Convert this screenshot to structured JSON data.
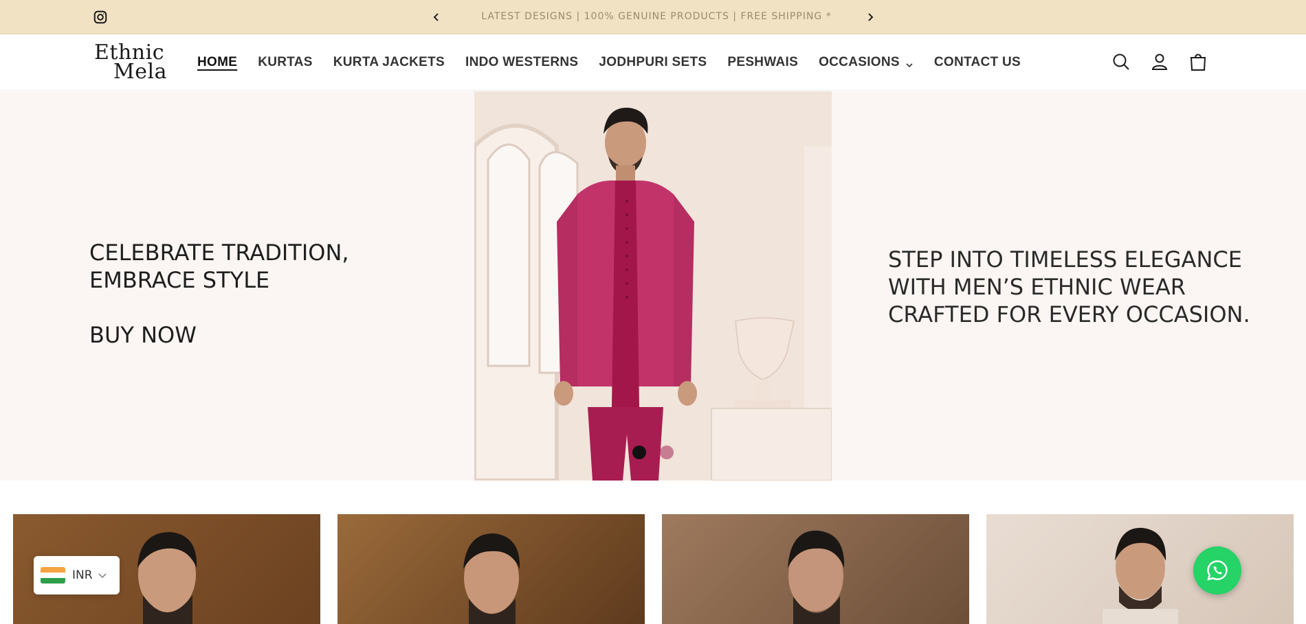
{
  "announcement": {
    "message": "LATEST DESIGNS | 100% GENUINE PRODUCTS | FREE SHIPPING *",
    "instagram_icon": "instagram-icon",
    "prev_icon": "chevron-left-icon",
    "next_icon": "chevron-right-icon"
  },
  "header": {
    "logo_line1": "Ethnic",
    "logo_line2": "Mela",
    "nav": [
      {
        "label": "HOME",
        "active": true
      },
      {
        "label": "KURTAS"
      },
      {
        "label": "KURTA JACKETS"
      },
      {
        "label": "INDO WESTERNS"
      },
      {
        "label": "JODHPURI SETS"
      },
      {
        "label": "PESHWAIS"
      },
      {
        "label": "OCCASIONS",
        "dropdown": true
      },
      {
        "label": "CONTACT US"
      }
    ],
    "icons": [
      "search-icon",
      "account-icon",
      "cart-icon"
    ]
  },
  "hero": {
    "left_line1": "CELEBRATE TRADITION,",
    "left_line2": "EMBRACE STYLE",
    "cta": "BUY NOW",
    "right_line1": "STEP INTO TIMELESS ELEGANCE",
    "right_line2": "WITH MEN’S ETHNIC WEAR",
    "right_line3": "CRAFTED FOR EVERY OCCASION.",
    "slides_total": 2,
    "active_slide": 1
  },
  "currency": {
    "code": "INR"
  },
  "colors": {
    "announcement_bg": "#f2e2c4",
    "hero_bg": "#fbf6f3",
    "jacket": "#c2336a",
    "kurta": "#a3164a",
    "whatsapp": "#25d366"
  }
}
